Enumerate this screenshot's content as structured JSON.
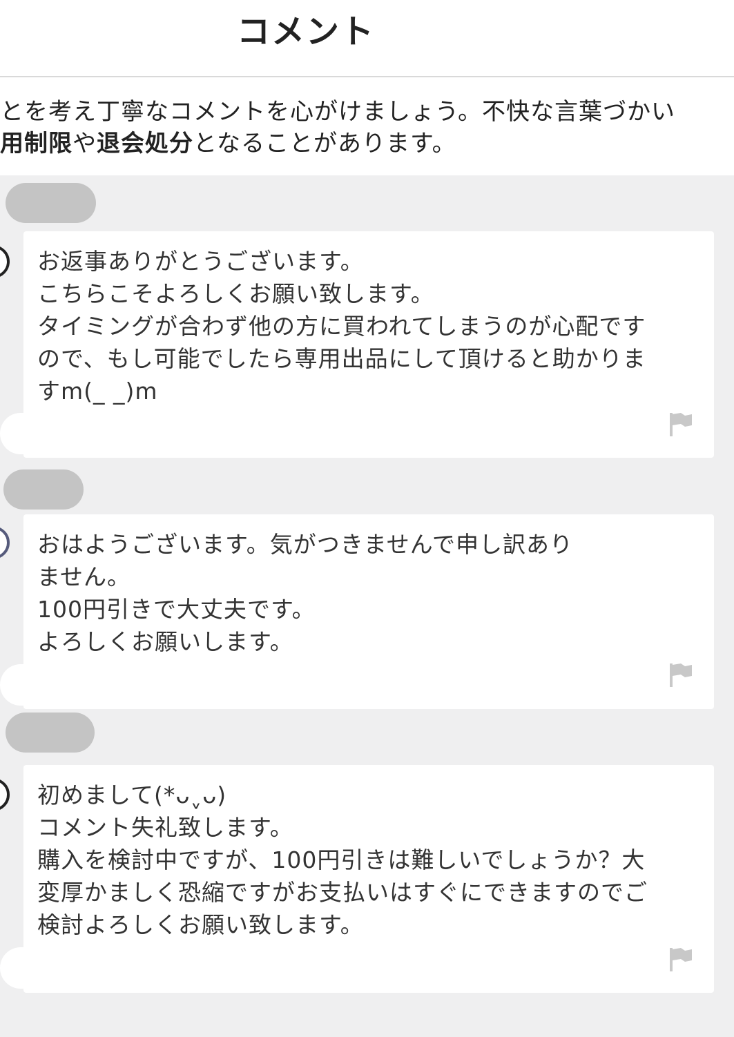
{
  "header": {
    "title": "コメント"
  },
  "notice": {
    "line1": "とを考え丁寧なコメントを心がけましょう。不快な言葉づかい",
    "line2_bold1": "用制限",
    "line2_text1": "や",
    "line2_bold2": "退会処分",
    "line2_text2": "となることがあります。"
  },
  "comments": [
    {
      "text": "お返事ありがとうございます。\nこちらこそよろしくお願い致します。\nタイミングが合わず他の方に買われてしまうのが心配です\nので、もし可能でしたら専用出品にして頂けると助かりま\nすm(_ _)m",
      "report_icon": "flag-icon"
    },
    {
      "text": "おはようございます。気がつきませんで申し訳あり\nません。\n100円引きで大丈夫です。\nよろしくお願いします。",
      "report_icon": "flag-icon"
    },
    {
      "text": "初めまして(*ᴗˬᴗ)\nコメント失礼致します。\n購入を検討中ですが、100円引きは難しいでしょうか？大\n変厚かましく恐縮ですがお支払いはすぐにできますのでご\n検討よろしくお願い致します。",
      "report_icon": "flag-icon"
    }
  ],
  "colors": {
    "background": "#efeff0",
    "bubble": "#ffffff",
    "name_redaction": "#c4c4c4",
    "flag": "#c8c8c8"
  }
}
